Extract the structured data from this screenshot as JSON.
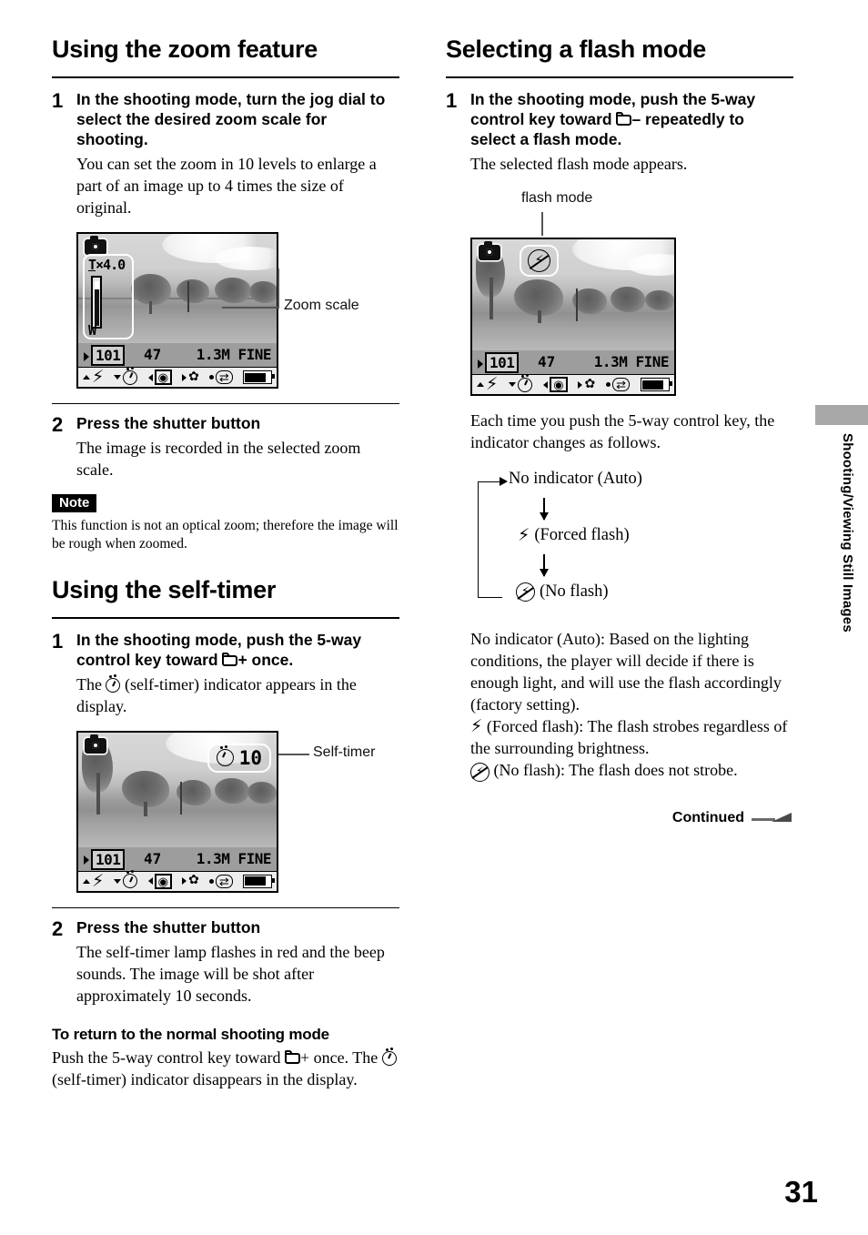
{
  "page": {
    "number": "31",
    "side_tab": "Shooting/Viewing Still Images",
    "continued": "Continued"
  },
  "left_column": {
    "section1": {
      "title": "Using the zoom feature",
      "steps": [
        {
          "num": "1",
          "head": "In the shooting mode, turn the jog dial to select the desired zoom scale for shooting.",
          "body": "You can set the zoom in 10 levels to enlarge a part of an image up to 4 times the size of original."
        },
        {
          "num": "2",
          "head": "Press the shutter button",
          "body": "The image is recorded in the selected zoom scale."
        }
      ],
      "note_label": "Note",
      "note_text": "This function is not an optical zoom; therefore the image will be rough when zoomed.",
      "callout_label": "Zoom scale"
    },
    "section2": {
      "title": "Using the self-timer",
      "steps": [
        {
          "num": "1",
          "head_pre": "In the shooting mode, push the 5-way control key toward ",
          "head_post": "+ once.",
          "body_pre": "The ",
          "body_post": " (self-timer) indicator appears in the display."
        },
        {
          "num": "2",
          "head": "Press the shutter button",
          "body": "The self-timer lamp flashes in red and the beep sounds. The image will be shot after approximately 10 seconds."
        }
      ],
      "subhead": "To return to the normal shooting mode",
      "return_pre": "Push the 5-way control key toward ",
      "return_mid": "+ once. The ",
      "return_post": " (self-timer) indicator disappears in the display.",
      "callout_label": "Self-timer"
    }
  },
  "right_column": {
    "section": {
      "title": "Selecting a flash mode",
      "step1": {
        "num": "1",
        "head_pre": "In the shooting mode, push the 5-way control key toward ",
        "head_post": "– repeatedly to select a flash mode.",
        "body": "The selected flash mode appears."
      },
      "callout_label": "flash mode",
      "intro": "Each time you push the 5-way control key, the indicator changes as follows.",
      "cycle": [
        {
          "icon": "none",
          "label": "No indicator (Auto)"
        },
        {
          "icon": "bolt",
          "label": "(Forced flash)"
        },
        {
          "icon": "no-flash",
          "label": "(No flash)"
        }
      ],
      "descriptions": [
        {
          "icon": "none",
          "text": "No indicator (Auto): Based on the lighting conditions, the player will decide if there is enough light, and will use the flash accordingly (factory setting)."
        },
        {
          "icon": "bolt",
          "text": "(Forced flash): The flash strobes regardless of the surrounding brightness."
        },
        {
          "icon": "no-flash",
          "text": "(No flash): The flash does not strobe."
        }
      ]
    }
  },
  "lcd": {
    "zoom_screen": {
      "zoom_tele_letter": "T",
      "zoom_value": "×4.0",
      "zoom_wide_letter": "W",
      "folder": "101",
      "shots": "47",
      "quality": "1.3M FINE"
    },
    "selftimer_screen": {
      "timer_value": "10",
      "folder": "101",
      "shots": "47",
      "quality": "1.3M FINE"
    },
    "flash_screen": {
      "folder": "101",
      "shots": "47",
      "quality": "1.3M FINE"
    }
  }
}
